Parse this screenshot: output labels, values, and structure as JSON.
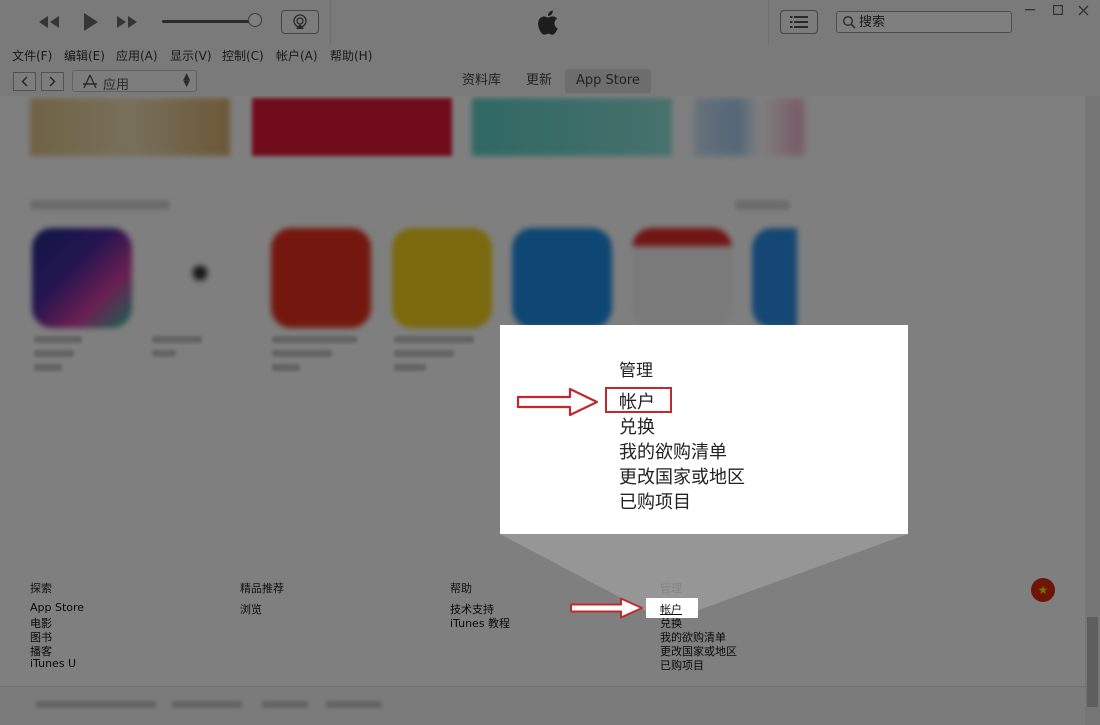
{
  "search": {
    "placeholder": "搜索"
  },
  "menu": [
    "文件(F)",
    "编辑(E)",
    "应用(A)",
    "显示(V)",
    "控制(C)",
    "帐户(A)",
    "帮助(H)"
  ],
  "nav": {
    "media_select": "应用",
    "tabs": [
      "资料库",
      "更新",
      "App Store"
    ],
    "active_tab": "App Store"
  },
  "footer": {
    "columns": [
      {
        "title": "探索",
        "links": [
          "App Store",
          "电影",
          "图书",
          "播客",
          "iTunes U"
        ]
      },
      {
        "title": "精品推荐",
        "links": [
          "浏览"
        ]
      },
      {
        "title": "帮助",
        "links": [
          "技术支持",
          "iTunes 教程"
        ]
      },
      {
        "title": "管理",
        "links": [
          "帐户",
          "兑换",
          "我的欲购清单",
          "更改国家或地区",
          "已购项目"
        ]
      }
    ]
  },
  "callout": {
    "title": "管理",
    "items": [
      "帐户",
      "兑换",
      "我的欲购清单",
      "更改国家或地区",
      "已购项目"
    ],
    "highlighted": "帐户"
  },
  "colors": {
    "highlight_red": "#c0282d",
    "active_tab_bg": "#dadada",
    "flag_red": "#de2910"
  },
  "icons": {
    "flag": "china-flag-icon",
    "apple": "apple-logo-icon"
  }
}
